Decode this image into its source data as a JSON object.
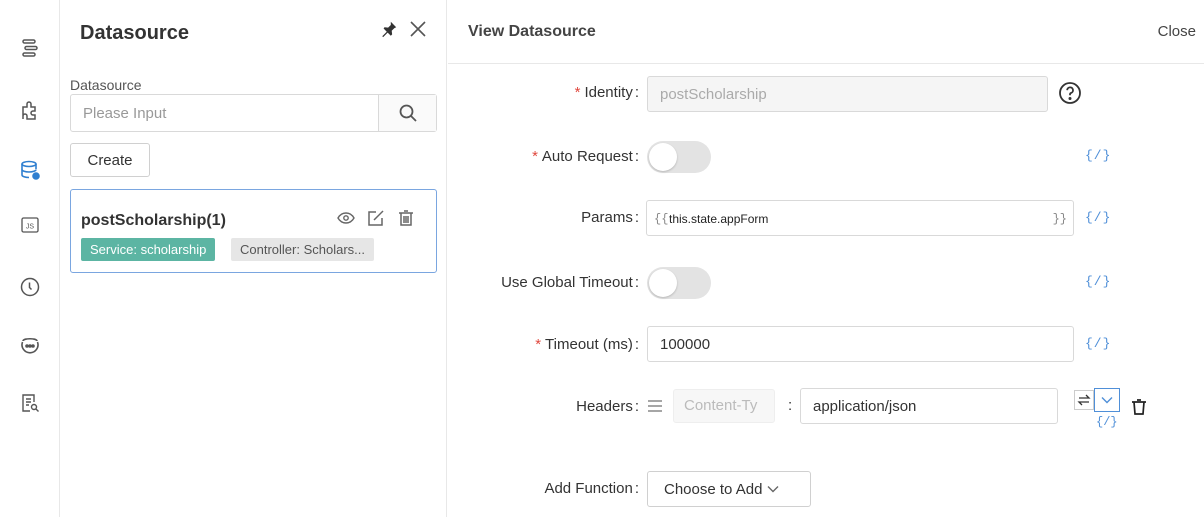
{
  "rail": {
    "icons": [
      "outline-icon",
      "plugin-icon",
      "datasource-icon",
      "js-icon",
      "history-icon",
      "ai-icon",
      "search-doc-icon"
    ]
  },
  "panel": {
    "title": "Datasource",
    "field_label": "Datasource",
    "search_placeholder": "Please Input",
    "create_label": "Create",
    "card": {
      "name": "postScholarship(1)",
      "service_tag": "Service: scholarship",
      "controller_tag": "Controller: Scholars..."
    }
  },
  "main": {
    "title": "View Datasource",
    "close_label": "Close",
    "identity": {
      "label": "Identity",
      "value": "postScholarship"
    },
    "auto_request": {
      "label": "Auto Request"
    },
    "params": {
      "label": "Params",
      "open": "{{",
      "value": "this.state.appForm",
      "close": "}}"
    },
    "global_timeout": {
      "label": "Use Global Timeout"
    },
    "timeout": {
      "label": "Timeout (ms)",
      "value": "100000"
    },
    "headers": {
      "label": "Headers",
      "key": "Content-Ty",
      "value": "application/json"
    },
    "add_function": {
      "label": "Add Function",
      "select": "Choose to Add"
    },
    "fx_label": "{/}",
    "required_mark": "*",
    "colon": ":"
  },
  "colors": {
    "accent": "#4f8fd8",
    "service_tag": "#5cb5a3",
    "required": "#e0483e"
  }
}
